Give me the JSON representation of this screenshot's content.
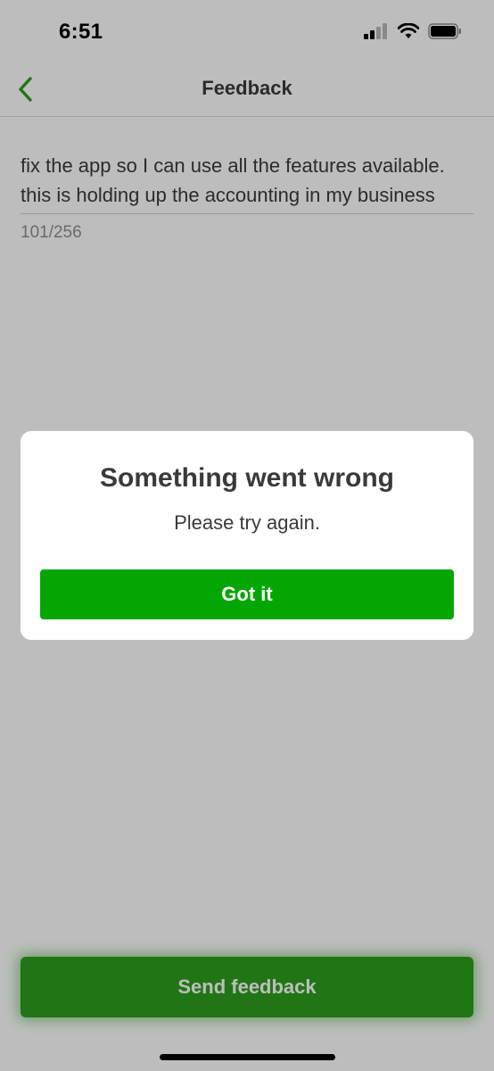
{
  "status_bar": {
    "time": "6:51"
  },
  "nav": {
    "title": "Feedback",
    "back_icon": "chevron-left-icon"
  },
  "feedback": {
    "text": "fix the app so I can use all the features available. this is holding up the accounting in my business",
    "char_count": "101/256"
  },
  "send_button": {
    "label": "Send feedback"
  },
  "dialog": {
    "title": "Something went wrong",
    "message": "Please try again.",
    "button_label": "Got it"
  },
  "colors": {
    "accent": "#2ca01c",
    "dialog_button": "#04a604",
    "text": "#393a3d"
  }
}
